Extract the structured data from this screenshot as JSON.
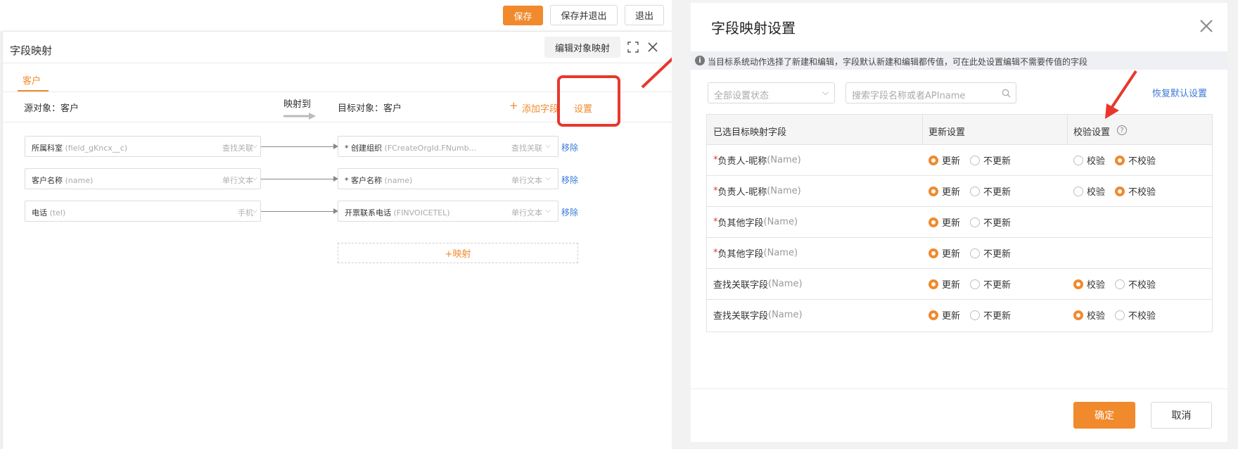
{
  "topbar": {
    "save": "保存",
    "save_exit": "保存并退出",
    "exit": "退出"
  },
  "dialog_left": {
    "title": "字段映射",
    "edit_object_mapping": "编辑对象映射",
    "tab": "客户",
    "source_object": "源对象：客户",
    "mapped_to": "映射到",
    "target_object": "目标对象：客户",
    "add_field": "添加字段",
    "settings": "设置",
    "remove": "移除",
    "add_mapping": "+映射",
    "rows": [
      {
        "src_label": "所属科室",
        "src_api": "(field_gKncx__c)",
        "src_type": "查找关联",
        "tgt_label": "* 创建组织",
        "tgt_api": "(FCreateOrgId.FNumb...",
        "tgt_type": "查找关联"
      },
      {
        "src_label": "客户名称",
        "src_api": "(name)",
        "src_type": "单行文本",
        "tgt_label": "* 客户名称",
        "tgt_api": "(name)",
        "tgt_type": "单行文本"
      },
      {
        "src_label": "电话",
        "src_api": "(tel)",
        "src_type": "手机",
        "tgt_label": "开票联系电话",
        "tgt_api": "(FINVOICETEL)",
        "tgt_type": "单行文本"
      }
    ]
  },
  "dialog_right": {
    "title": "字段映射设置",
    "info": "当目标系统动作选择了新建和编辑，字段默认新建和编辑都传值，可在此处设置编辑不需要传值的字段",
    "filter_placeholder": "全部设置状态",
    "search_placeholder": "搜索字段名称或者APIname",
    "restore_default": "恢复默认设置",
    "columns": [
      "已选目标映射字段",
      "更新设置",
      "校验设置"
    ],
    "update_label": "更新",
    "no_update_label": "不更新",
    "verify_label": "校验",
    "no_verify_label": "不校验",
    "rows": [
      {
        "required": "*",
        "name": "负责人-昵称",
        "api": "(Name)",
        "update": true,
        "has_verify": true,
        "verify": false
      },
      {
        "required": "*",
        "name": "负责人-昵称",
        "api": "(Name)",
        "update": true,
        "has_verify": true,
        "verify": false
      },
      {
        "required": "*",
        "name": "负其他字段",
        "api": "(Name)",
        "update": true,
        "has_verify": false
      },
      {
        "required": "*",
        "name": "负其他字段",
        "api": "(Name)",
        "update": true,
        "has_verify": false
      },
      {
        "required": "",
        "name": "查找关联字段",
        "api": "(Name)",
        "update": true,
        "has_verify": true,
        "verify": true
      },
      {
        "required": "",
        "name": "查找关联字段",
        "api": "(Name)",
        "update": true,
        "has_verify": true,
        "verify": true
      }
    ],
    "confirm": "确定",
    "cancel": "取消"
  },
  "colors": {
    "accent": "#f08a2c",
    "link": "#3a7bd5",
    "annotation": "#e8382c"
  }
}
